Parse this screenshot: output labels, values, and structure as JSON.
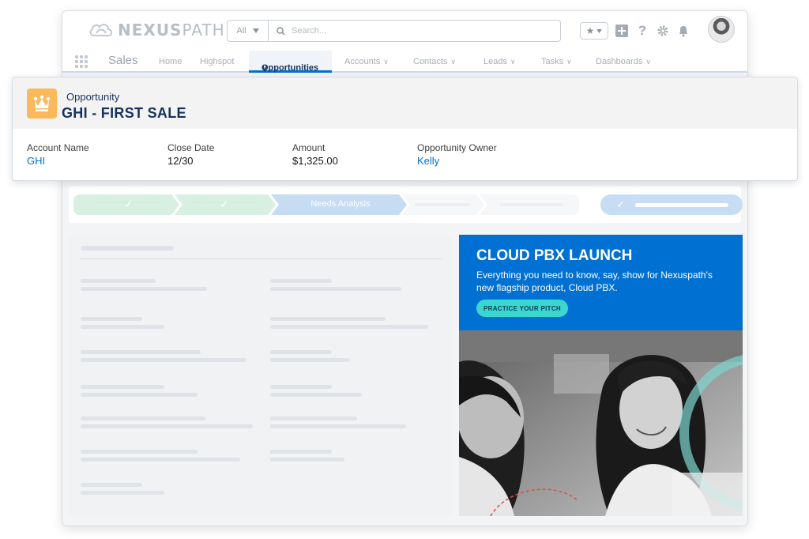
{
  "header": {
    "logo_text_bold": "NEXUS",
    "logo_text_light": "PATH",
    "search_scope": "All",
    "search_placeholder": "Search..."
  },
  "nav": {
    "app_name": "Sales",
    "items": [
      {
        "label": "Home",
        "dropdown": false
      },
      {
        "label": "Highspot",
        "dropdown": false
      },
      {
        "label": "Opportunities",
        "dropdown": true,
        "active": true
      },
      {
        "label": "Accounts",
        "dropdown": true
      },
      {
        "label": "Contacts",
        "dropdown": true
      },
      {
        "label": "Leads",
        "dropdown": true
      },
      {
        "label": "Tasks",
        "dropdown": true
      },
      {
        "label": "Dashboards",
        "dropdown": true
      }
    ]
  },
  "record": {
    "type": "Opportunity",
    "title": "GHI - FIRST SALE",
    "icon": "crown-icon",
    "icon_color": "#fcb95b",
    "fields": [
      {
        "label": "Account Name",
        "value": "GHI",
        "link": true
      },
      {
        "label": "Close Date",
        "value": "12/30",
        "link": false
      },
      {
        "label": "Amount",
        "value": "$1,325.00",
        "link": false
      },
      {
        "label": "Opportunity Owner",
        "value": "Kelly",
        "link": true
      }
    ]
  },
  "path": {
    "current_stage": "Needs Analysis"
  },
  "promo": {
    "title": "CLOUD PBX LAUNCH",
    "text": "Everything you need to know, say, show for Nexuspath's new flagship product, Cloud PBX.",
    "button_label": "PRACTICE YOUR PITCH",
    "background_color": "#0070d2",
    "button_color": "#3bd6cf"
  },
  "colors": {
    "link": "#0070d2",
    "title_text": "#16325c",
    "nav_active_border": "#0070d2"
  }
}
